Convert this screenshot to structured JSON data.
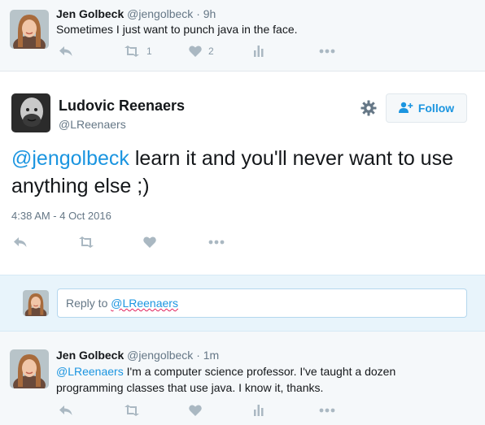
{
  "ancestor_tweet": {
    "name": "Jen Golbeck",
    "handle": "@jengolbeck",
    "dot": "·",
    "time": "9h",
    "text": "Sometimes I just want to punch java in the face.",
    "retweets": "1",
    "likes": "2"
  },
  "main_tweet": {
    "name": "Ludovic Reenaers",
    "handle": "@LReenaers",
    "mention": "@jengolbeck",
    "text_rest": " learn it and you'll never want to use anything else ;)",
    "timestamp": "4:38 AM - 4 Oct 2016",
    "follow_label": "Follow"
  },
  "reply_box": {
    "prefix": "Reply to ",
    "handle": "@LReenaers"
  },
  "reply_tweet": {
    "name": "Jen Golbeck",
    "handle": "@jengolbeck",
    "dot": "·",
    "time": "1m",
    "mention": "@LReenaers",
    "text_rest": " I'm a computer science professor. I've taught a dozen programming classes that use java. I know it, thanks."
  },
  "colors": {
    "link": "#1b95e0",
    "icon": "#aab8c2",
    "secondary_text": "#657786"
  }
}
